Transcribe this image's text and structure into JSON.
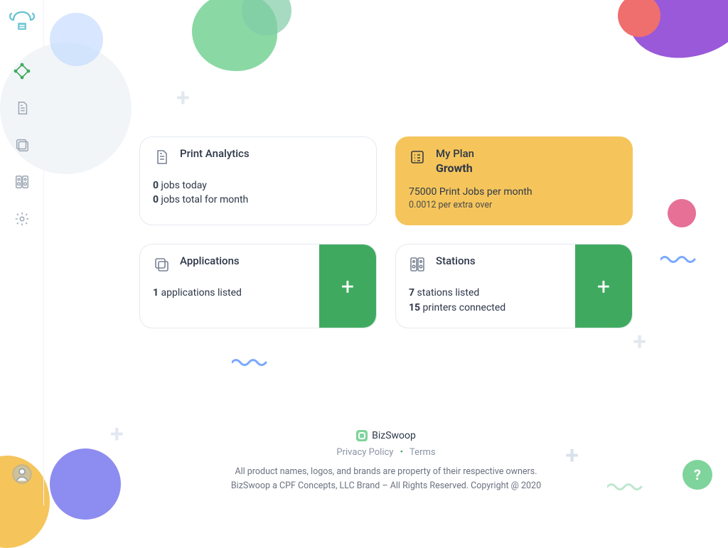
{
  "sidebar": {
    "items": [
      {
        "name": "dashboard"
      },
      {
        "name": "documents"
      },
      {
        "name": "applications"
      },
      {
        "name": "stations"
      },
      {
        "name": "settings"
      }
    ]
  },
  "analytics": {
    "title": "Print Analytics",
    "today_count": "0",
    "today_label": " jobs today",
    "month_count": "0",
    "month_label": " jobs total for month"
  },
  "plan": {
    "title": "My Plan",
    "name": "Growth",
    "limit": "75000 Print Jobs per month",
    "extra": "0.0012 per extra over"
  },
  "apps": {
    "title": "Applications",
    "count": "1",
    "label": " applications listed"
  },
  "stations": {
    "title": "Stations",
    "station_count": "7",
    "station_label": " stations listed",
    "printer_count": "15",
    "printer_label": " printers connected"
  },
  "footer": {
    "brand": "BizSwoop",
    "privacy": "Privacy Policy",
    "terms": "Terms",
    "line1": "All product names, logos, and brands are property of their respective owners.",
    "line2": "BizSwoop a CPF Concepts, LLC Brand – All Rights Reserved. Copyright @ 2020"
  },
  "help": {
    "label": "?"
  }
}
